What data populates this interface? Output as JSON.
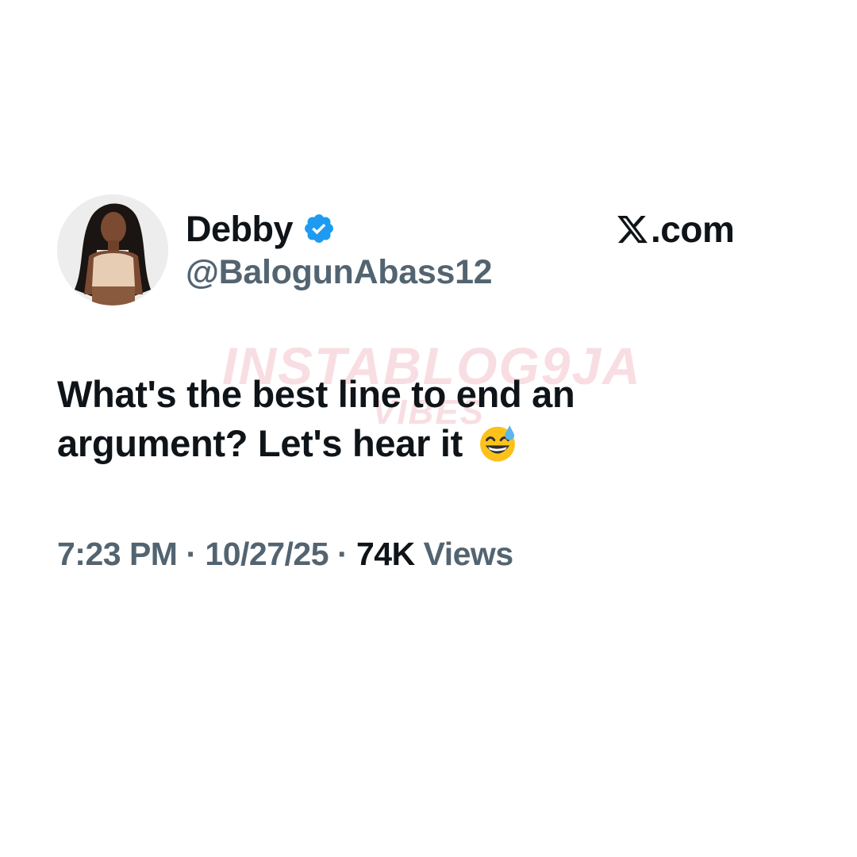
{
  "tweet": {
    "author": {
      "display_name": "Debby",
      "handle": "@BalogunAbass12",
      "verified": true,
      "verified_color": "#1d9bf0"
    },
    "brand": ".com",
    "brand_icon": "x-logo-icon",
    "text_line1": "What's the best line to end an",
    "text_line2": "argument? Let's hear it",
    "emoji": "grinning-face-with-sweat-icon",
    "meta": {
      "time": "7:23 PM",
      "date": "10/27/25",
      "views_count": "74K",
      "views_label": "Views",
      "separator": "·"
    }
  },
  "watermark": {
    "line1": "INSTABLOG9JA",
    "line2": "VIBES"
  },
  "colors": {
    "text_primary": "#0f1419",
    "text_secondary": "#536471",
    "background": "#ffffff"
  }
}
